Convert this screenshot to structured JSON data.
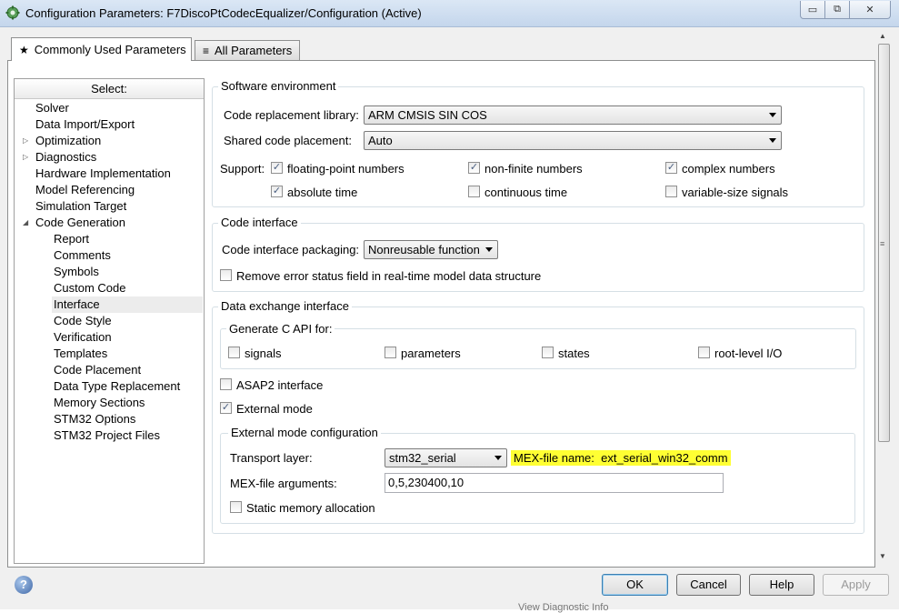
{
  "window": {
    "title": "Configuration Parameters: F7DiscoPtCodecEqualizer/Configuration (Active)",
    "min_glyph": "▭",
    "max_glyph": "⧉",
    "close_glyph": "✕"
  },
  "tabs": [
    {
      "label": "Commonly Used Parameters",
      "glyph": "★"
    },
    {
      "label": "All Parameters",
      "glyph": "≡"
    }
  ],
  "tree": {
    "header": "Select:",
    "items": [
      {
        "label": "Solver",
        "level": 0
      },
      {
        "label": "Data Import/Export",
        "level": 0
      },
      {
        "label": "Optimization",
        "level": 0,
        "arrow": "▷"
      },
      {
        "label": "Diagnostics",
        "level": 0,
        "arrow": "▷"
      },
      {
        "label": "Hardware Implementation",
        "level": 0
      },
      {
        "label": "Model Referencing",
        "level": 0
      },
      {
        "label": "Simulation Target",
        "level": 0
      },
      {
        "label": "Code Generation",
        "level": 0,
        "arrow": "◢"
      },
      {
        "label": "Report",
        "level": 1
      },
      {
        "label": "Comments",
        "level": 1
      },
      {
        "label": "Symbols",
        "level": 1
      },
      {
        "label": "Custom Code",
        "level": 1
      },
      {
        "label": "Interface",
        "level": 1,
        "selected": true
      },
      {
        "label": "Code Style",
        "level": 1
      },
      {
        "label": "Verification",
        "level": 1
      },
      {
        "label": "Templates",
        "level": 1
      },
      {
        "label": "Code Placement",
        "level": 1
      },
      {
        "label": "Data Type Replacement",
        "level": 1
      },
      {
        "label": "Memory Sections",
        "level": 1
      },
      {
        "label": "STM32 Options",
        "level": 1
      },
      {
        "label": "STM32 Project Files",
        "level": 1
      }
    ]
  },
  "software_env": {
    "title": "Software environment",
    "crl_label": "Code replacement library:",
    "crl_value": "ARM CMSIS SIN COS",
    "shared_label": "Shared code placement:",
    "shared_value": "Auto",
    "support_label": "Support:",
    "checks": [
      {
        "label": "floating-point numbers",
        "checked": true
      },
      {
        "label": "non-finite numbers",
        "checked": true
      },
      {
        "label": "complex numbers",
        "checked": true
      },
      {
        "label": "absolute time",
        "checked": true
      },
      {
        "label": "continuous time",
        "checked": false
      },
      {
        "label": "variable-size signals",
        "checked": false
      }
    ]
  },
  "code_interface": {
    "title": "Code interface",
    "packaging_label": "Code interface packaging:",
    "packaging_value": "Nonreusable function",
    "remove_error_label": "Remove error status field in real-time model data structure",
    "remove_error_checked": false
  },
  "data_exchange": {
    "title": "Data exchange interface",
    "capi_title": "Generate C API for:",
    "capi_checks": [
      {
        "label": "signals",
        "checked": false
      },
      {
        "label": "parameters",
        "checked": false
      },
      {
        "label": "states",
        "checked": false
      },
      {
        "label": "root-level I/O",
        "checked": false
      }
    ],
    "asap2_label": "ASAP2 interface",
    "asap2_checked": false,
    "external_label": "External mode",
    "external_checked": true,
    "ext_config_title": "External mode configuration",
    "transport_label": "Transport layer:",
    "transport_value": "stm32_serial",
    "mex_name_label": "MEX-file name:",
    "mex_name_value": "ext_serial_win32_comm",
    "mex_args_label": "MEX-file arguments:",
    "mex_args_value": "0,5,230400,10",
    "static_mem_label": "Static memory allocation",
    "static_mem_checked": false
  },
  "buttons": {
    "ok": "OK",
    "cancel": "Cancel",
    "help": "Help",
    "apply": "Apply",
    "help_icon": "?"
  },
  "check_glyph": "✓",
  "scroll": {
    "up": "▲",
    "down": "▼",
    "grip": "≡"
  },
  "ghost_text": "View Diagnostic Info"
}
